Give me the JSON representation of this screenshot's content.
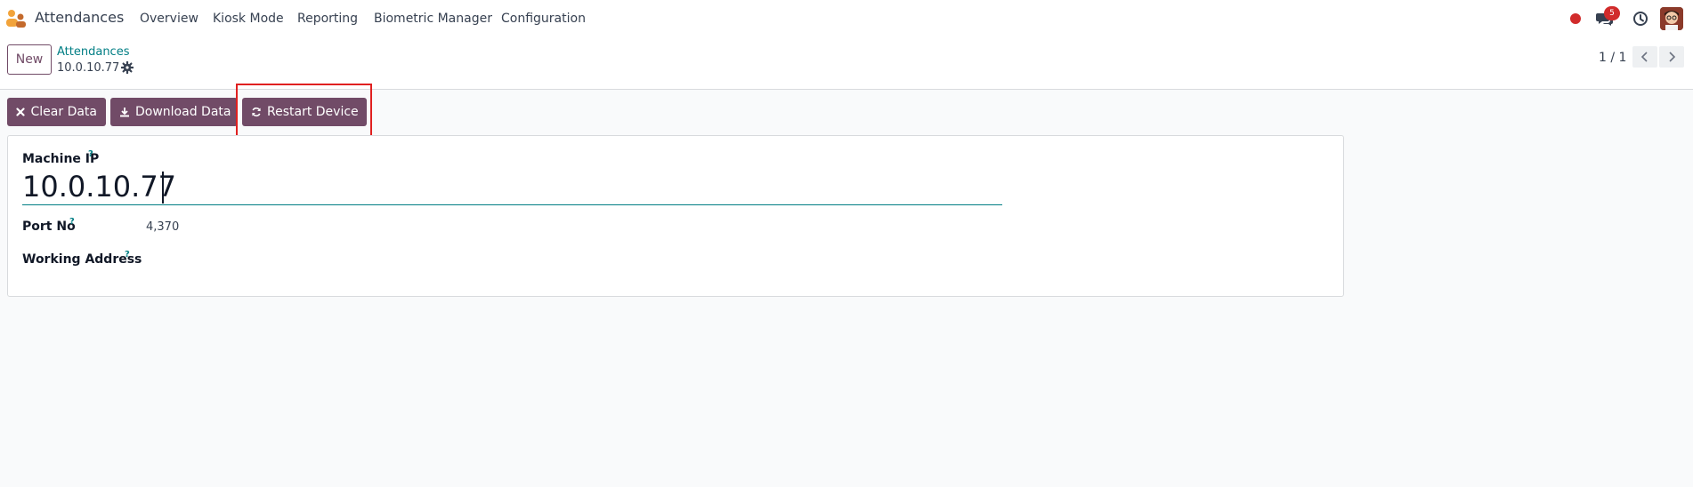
{
  "navbar": {
    "app_name": "Attendances",
    "menu": [
      "Overview",
      "Kiosk Mode",
      "Reporting",
      "Biometric Manager",
      "Configuration"
    ],
    "chat_badge": "5",
    "icons": {
      "app": "attendances-app-icon",
      "record": "recording-dot-icon",
      "chat": "chat-icon",
      "activity": "clock-icon",
      "user": "user-avatar"
    }
  },
  "control_panel": {
    "new_label": "New",
    "breadcrumb_parent": "Attendances",
    "breadcrumb_current": "10.0.10.77",
    "pager_value": "1 / 1"
  },
  "actions": {
    "clear_data": "Clear Data",
    "download_data": "Download Data",
    "restart_device": "Restart Device"
  },
  "form": {
    "machine_ip_label": "Machine IP",
    "machine_ip_value": "10.0.10.77",
    "port_no_label": "Port No",
    "port_no_value": "4,370",
    "working_address_label": "Working Address",
    "working_address_value": "",
    "help_marker": "?"
  },
  "colors": {
    "brand": "#714b67",
    "link": "#017e84",
    "highlight": "#e02020",
    "badge": "#d12b2b"
  }
}
